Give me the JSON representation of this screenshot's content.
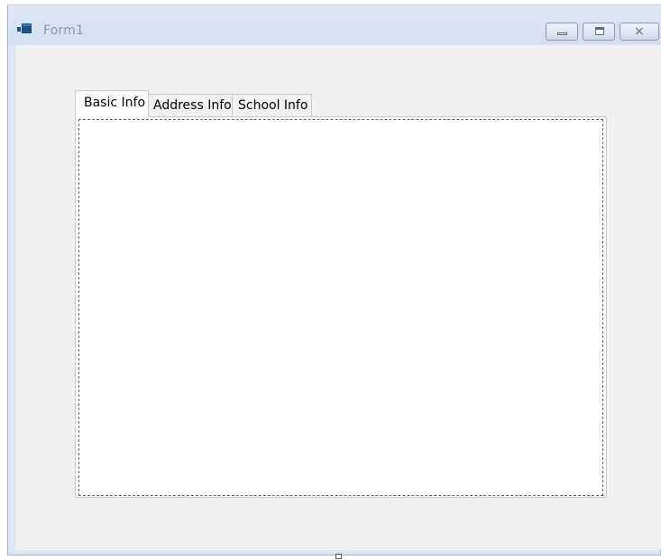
{
  "window": {
    "title": "Form1",
    "icons": {
      "app": "form-app-icon",
      "minimize": "minimize-icon",
      "maximize": "maximize-icon",
      "close": "close-icon"
    },
    "close_glyph": "⨯"
  },
  "tabs": [
    {
      "label": "Basic Info",
      "selected": true
    },
    {
      "label": "Address Info",
      "selected": false
    },
    {
      "label": "School Info",
      "selected": false
    }
  ],
  "colors": {
    "titlebar": "#d3e0ef",
    "client": "#f0f0f0",
    "tab_page": "#ffffff",
    "border": "#c9c9c9"
  }
}
